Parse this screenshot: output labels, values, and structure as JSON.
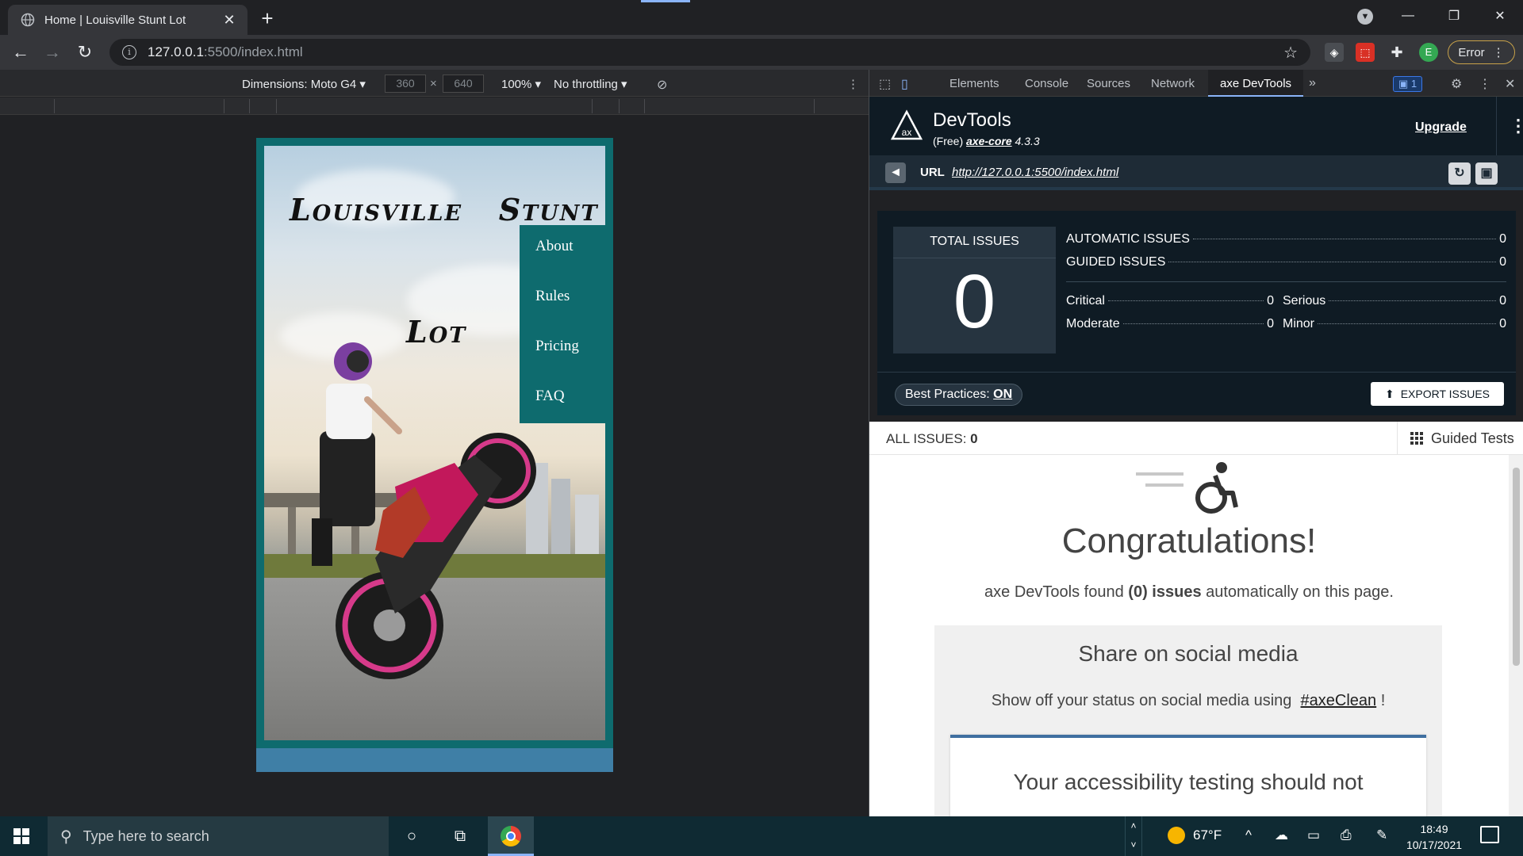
{
  "browser": {
    "tab_title": "Home | Louisville Stunt Lot",
    "url_host": "127.0.0.1",
    "url_path": ":5500/index.html",
    "error_label": "Error",
    "profile_initial": "E"
  },
  "device_toolbar": {
    "dimensions_label": "Dimensions: Moto G4",
    "width": "360",
    "height": "640",
    "zoom": "100%",
    "throttling": "No throttling"
  },
  "page": {
    "title_line1": "Louisville   Stunt",
    "title_line2": "Lot",
    "nav": [
      "About",
      "Rules",
      "Pricing",
      "FAQ"
    ],
    "colors": {
      "frame": "#0e6b6e",
      "footer": "#3f7fa6"
    }
  },
  "devtools": {
    "tabs": [
      "Elements",
      "Console",
      "Sources",
      "Network",
      "axe DevTools"
    ],
    "active_tab": "axe DevTools",
    "message_count": "1",
    "axe": {
      "name": "DevTools",
      "free_label": "(Free)",
      "core_label": "axe-core",
      "core_version": "4.3.3",
      "upgrade_label": "Upgrade",
      "url_label": "URL",
      "url_value": "http://127.0.0.1:5500/index.html",
      "total_issues_label": "TOTAL ISSUES",
      "total_issues": "0",
      "automatic_label": "AUTOMATIC ISSUES",
      "automatic": "0",
      "guided_label": "GUIDED ISSUES",
      "guided": "0",
      "critical_label": "Critical",
      "critical": "0",
      "serious_label": "Serious",
      "serious": "0",
      "moderate_label": "Moderate",
      "moderate": "0",
      "minor_label": "Minor",
      "minor": "0",
      "best_practices_label": "Best Practices:",
      "best_practices_value": "ON",
      "export_label": "EXPORT ISSUES",
      "all_issues_label": "ALL ISSUES:",
      "all_issues": "0",
      "guided_tests_label": "Guided Tests",
      "congrats": "Congratulations!",
      "found_prefix": "axe DevTools found",
      "found_count": "(0)",
      "found_issues": "issues",
      "found_suffix": "automatically on this page.",
      "share_title": "Share on social media",
      "share_text": "Show off your status on social media using",
      "share_tag": "#axeClean",
      "share_end": "!",
      "card_text": "Your accessibility testing should not"
    }
  },
  "taskbar": {
    "search_placeholder": "Type here to search",
    "temperature": "67°F",
    "time": "18:49",
    "date": "10/17/2021"
  }
}
